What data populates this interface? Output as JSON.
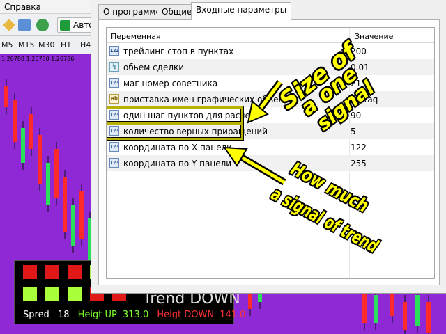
{
  "terminal": {
    "menu_help": "Справка",
    "autotrade_label": "Авто",
    "timeframes": [
      "M5",
      "M15",
      "M30",
      "H1",
      "H4"
    ],
    "price_labels": [
      "1.20788",
      "1.20780",
      "1.20786"
    ]
  },
  "signal_panel": {
    "trend_text": "Trend DOWN",
    "spread_label": "Spred",
    "spread_value": "18",
    "up_label": "Heigt UP",
    "up_value": "313.0",
    "down_label": "Heigt DOWN",
    "down_value": "141.0",
    "colors": {
      "red": "#e01818",
      "green": "#a8ff3a",
      "up_text": "#7cff2a",
      "down_text": "#ff3232",
      "spread_text": "#ffffff"
    }
  },
  "dialog": {
    "tabs": [
      {
        "label": "О программе",
        "active": false
      },
      {
        "label": "Общие",
        "active": false
      },
      {
        "label": "Входные параметры",
        "active": true
      }
    ],
    "table": {
      "header_variable": "Переменная",
      "header_value": "Значение",
      "rows": [
        {
          "icon": "int-icon",
          "icon_text": "123",
          "name": "трейлинг стоп в пунктах",
          "value": "200",
          "highlighted": false
        },
        {
          "icon": "double-icon",
          "icon_text": "½",
          "name": "обьем сделки",
          "value": "0.01",
          "highlighted": false
        },
        {
          "icon": "int-icon",
          "icon_text": "123",
          "name": "маг номер советника",
          "value": "21",
          "highlighted": false
        },
        {
          "icon": "string-icon",
          "icon_text": "ab",
          "name": "приставка имен графических объектов",
          "value": "wwtaq",
          "highlighted": false
        },
        {
          "icon": "int-icon",
          "icon_text": "123",
          "name": "один шаг пунктов для расчета",
          "value": "90",
          "highlighted": true
        },
        {
          "icon": "int-icon",
          "icon_text": "123",
          "name": "количество верных приращений",
          "value": "5",
          "highlighted": true
        },
        {
          "icon": "int-icon",
          "icon_text": "123",
          "name": "координата по X панели",
          "value": "122",
          "highlighted": false
        },
        {
          "icon": "int-icon",
          "icon_text": "123",
          "name": "координата по Y панели",
          "value": "255",
          "highlighted": false
        }
      ]
    }
  },
  "annotations": {
    "top_text": [
      "Size of",
      "a one",
      "signal"
    ],
    "bottom_text": [
      "How much",
      "a signal of trend"
    ],
    "color": "#ffff00"
  }
}
